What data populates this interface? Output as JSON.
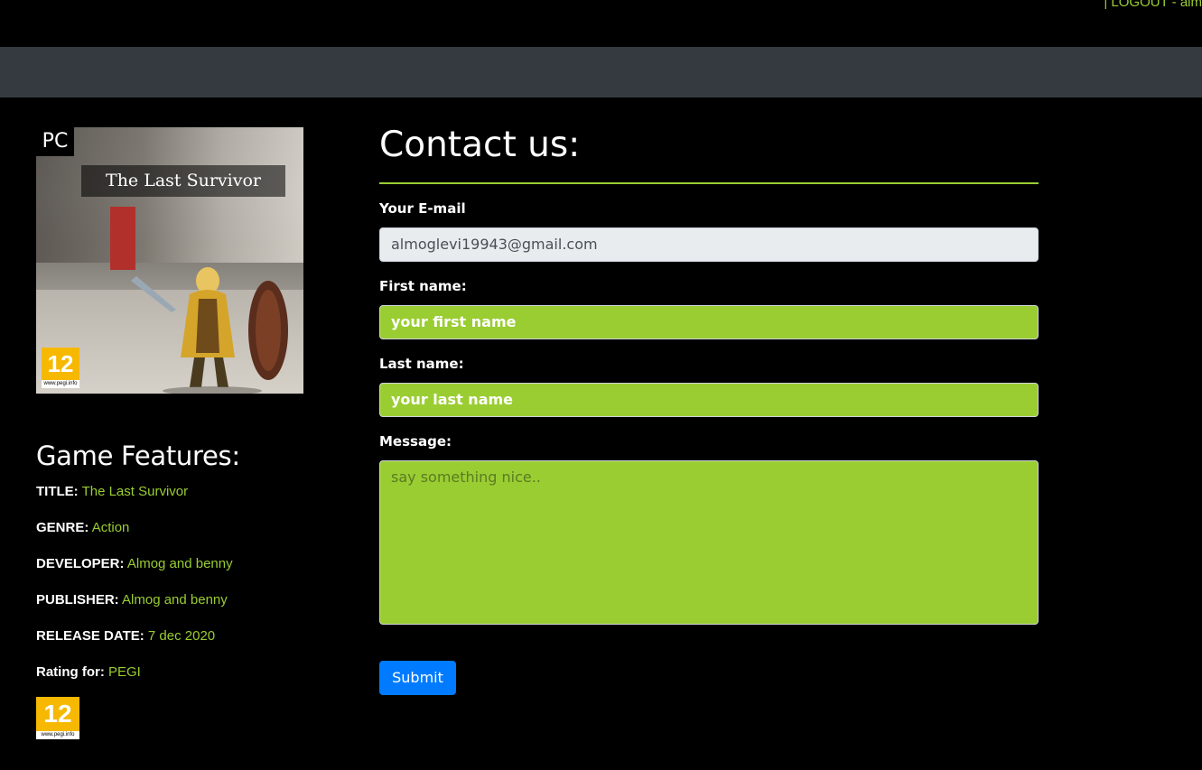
{
  "top_links": {
    "logout": "| LOGOUT",
    "user": "- alm"
  },
  "cover": {
    "platform": "PC",
    "game_title": "The Last Survivor",
    "pegi_number": "12",
    "pegi_site": "www.pegi.info"
  },
  "features": {
    "heading": "Game Features:",
    "items": [
      {
        "label": "TITLE:",
        "value": "The Last Survivor"
      },
      {
        "label": "GENRE:",
        "value": "Action"
      },
      {
        "label": "DEVELOPER:",
        "value": "Almog and benny"
      },
      {
        "label": "PUBLISHER:",
        "value": "Almog and benny"
      },
      {
        "label": "RELEASE DATE:",
        "value": "7 dec 2020"
      },
      {
        "label": "Rating for:",
        "value": "PEGI"
      }
    ],
    "rating_badge": {
      "number": "12",
      "site": "www.pegi.info"
    }
  },
  "contact": {
    "title": "Contact us:",
    "email_label": "Your E-mail",
    "email_value": "almoglevi19943@gmail.com",
    "first_label": "First name:",
    "first_value": "your first name",
    "last_label": "Last name:",
    "last_value": "your last name",
    "message_label": "Message:",
    "message_placeholder": "say something nice..",
    "submit_label": "Submit"
  },
  "colors": {
    "accent": "#9acd32",
    "navbar": "#343a40",
    "button": "#007bff",
    "background": "#000000"
  }
}
